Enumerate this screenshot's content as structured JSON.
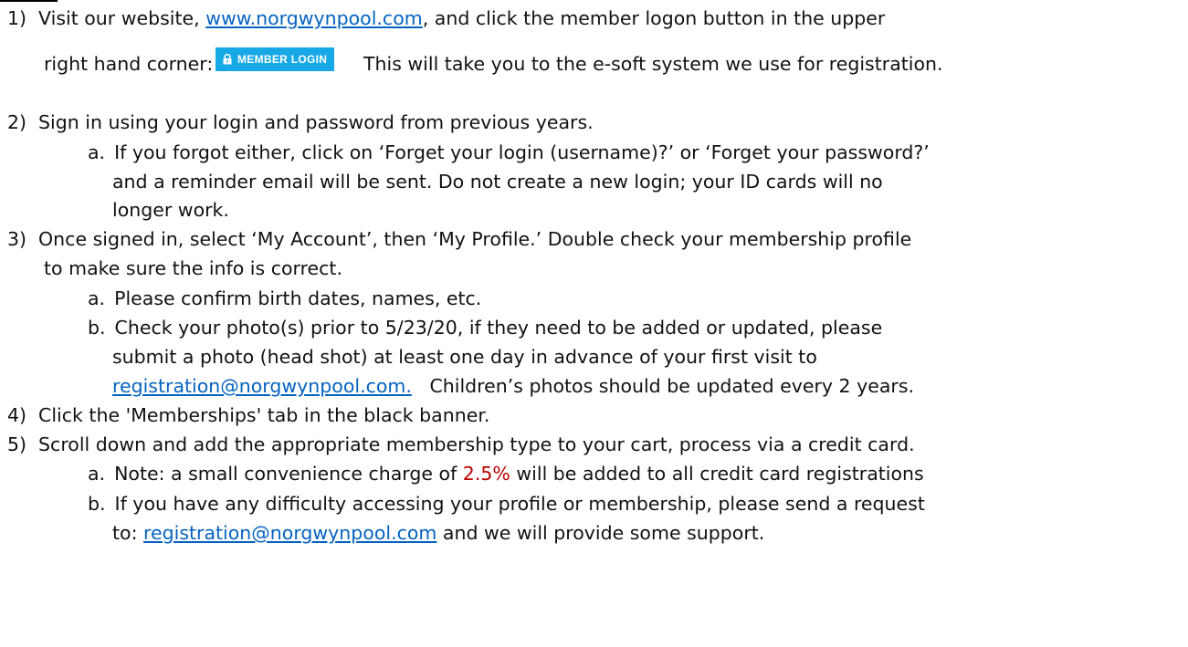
{
  "steps": {
    "s1": {
      "num": "1)",
      "pre": "Visit our website, ",
      "link": "www.norgwynpool.com",
      "post": ", and click the member logon button in the upper",
      "cont_pre": "right hand corner:",
      "button_label": "MEMBER LOGIN",
      "cont_post": "This will take you to the e-soft system we use for registration."
    },
    "s2": {
      "num": "2)",
      "text": "Sign in using your login and password from previous years.",
      "a_label": "a.",
      "a_line1": "If you forgot either, click on ‘Forget your login (username)?’ or ‘Forget your password?’",
      "a_line2": "and a reminder email will be sent.  Do not create a new login; your ID cards will no",
      "a_line3": "longer work."
    },
    "s3": {
      "num": "3)",
      "line1": "Once signed in, select ‘My Account’, then ‘My Profile.’  Double check your membership profile",
      "line2": "to make sure the info is correct.",
      "a_label": "a.",
      "a_text": "Please confirm birth dates, names, etc.",
      "b_label": "b.",
      "b_line1": "Check your photo(s) prior to 5/23/20, if they need to be added or updated, please",
      "b_line2": "submit a photo (head shot) at least one day in advance of your first visit to",
      "b_link": "registration@norgwynpool.com.",
      "b_post": "   Children’s photos should be updated every 2 years."
    },
    "s4": {
      "num": "4)",
      "text": "Click the 'Memberships' tab in the black banner."
    },
    "s5": {
      "num": "5)",
      "text": "Scroll down and add the appropriate membership type to your cart, process via a credit card.",
      "a_label": "a.",
      "a_pre": "Note: a small convenience charge of ",
      "a_highlight": "2.5%",
      "a_post": " will be added to all credit card registrations",
      "b_label": "b.",
      "b_line1": "If you have any difficulty accessing your profile or membership, please send a request",
      "b_pre": "to: ",
      "b_link": "registration@norgwynpool.com",
      "b_post": " and we will provide some support."
    }
  },
  "colors": {
    "link": "#0563c1",
    "highlight": "#c00000",
    "button_bg": "#17a9e6"
  },
  "icons": {
    "button_icon": "lock-icon"
  }
}
